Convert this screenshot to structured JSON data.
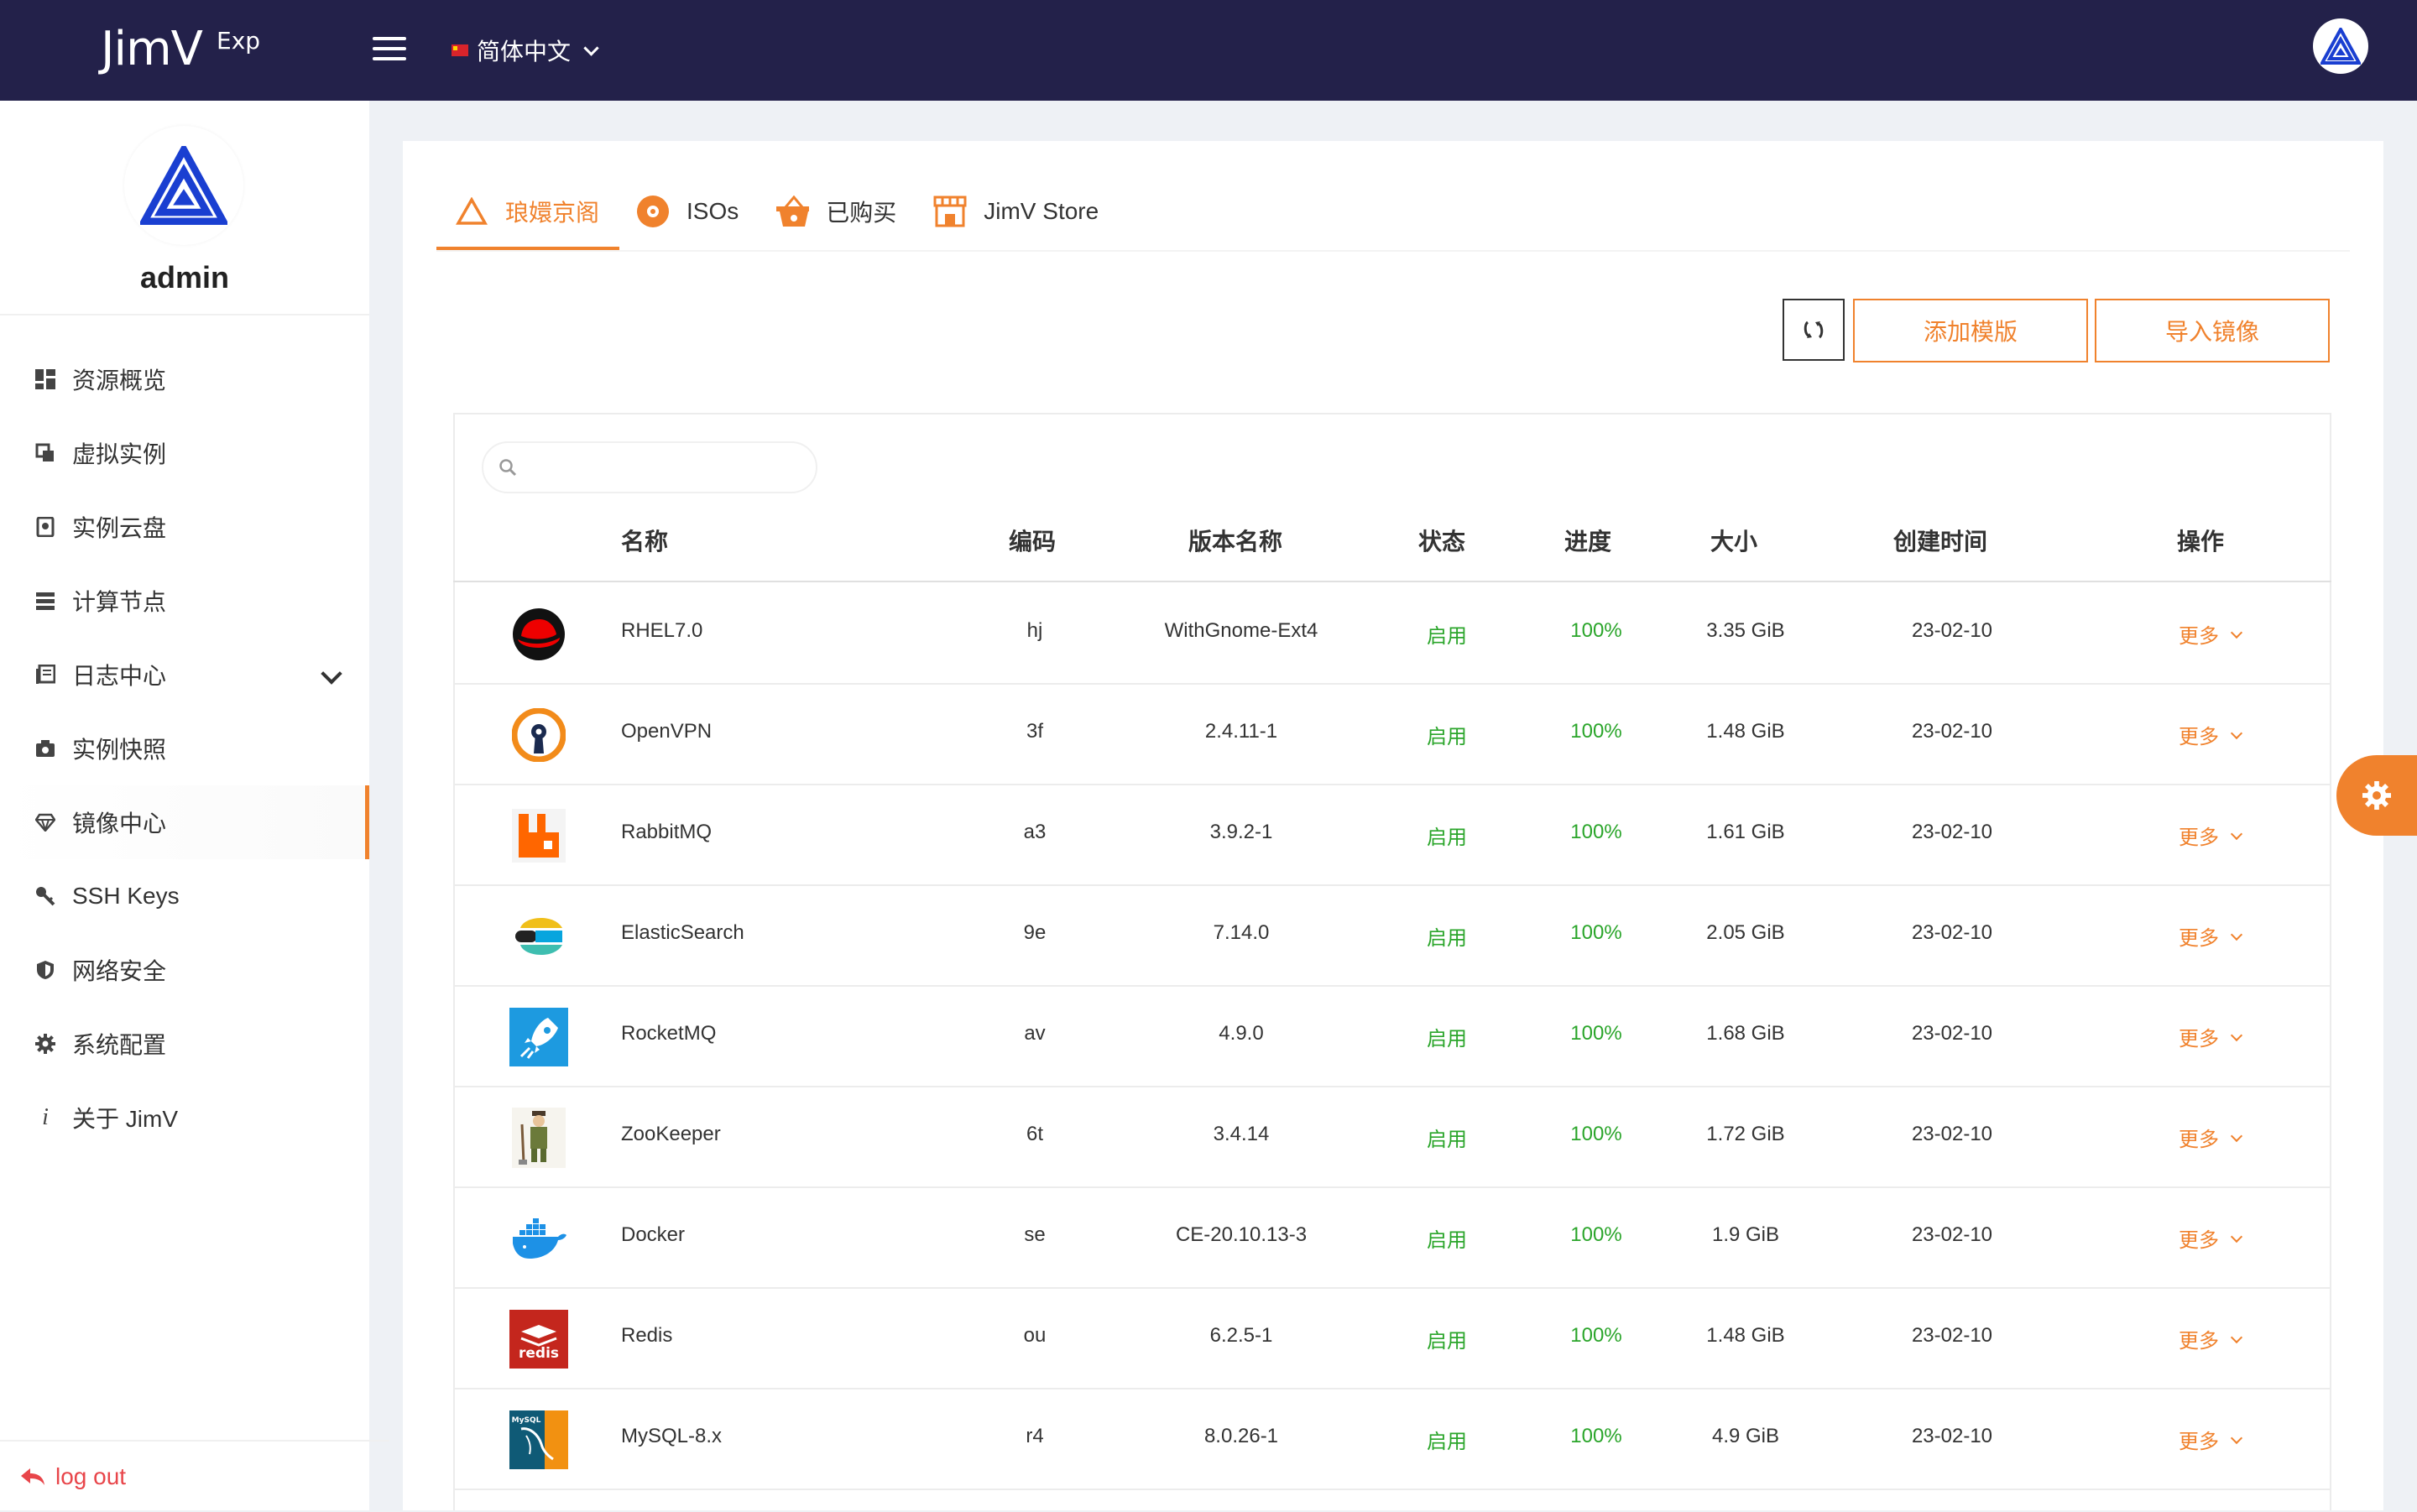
{
  "colors": {
    "topbar": "#23214a",
    "accent": "#f0822d",
    "status_ok": "#2aa52a",
    "logout": "#e8454a"
  },
  "header": {
    "logo": "JimV",
    "logo_sup": "Exp",
    "menu_icon": "hamburger-icon",
    "language": "简体中文"
  },
  "sidebar": {
    "username": "admin",
    "items": [
      {
        "label": "资源概览",
        "icon": "dashboard-icon"
      },
      {
        "label": "虚拟实例",
        "icon": "instances-icon"
      },
      {
        "label": "实例云盘",
        "icon": "disk-icon"
      },
      {
        "label": "计算节点",
        "icon": "server-icon"
      },
      {
        "label": "日志中心",
        "icon": "log-icon"
      },
      {
        "label": "实例快照",
        "icon": "camera-icon"
      },
      {
        "label": "镜像中心",
        "icon": "gem-icon"
      },
      {
        "label": "SSH Keys",
        "icon": "key-icon"
      },
      {
        "label": "网络安全",
        "icon": "shield-icon"
      },
      {
        "label": "系统配置",
        "icon": "gear-icon"
      },
      {
        "label": "关于 JimV",
        "icon": "info-icon"
      }
    ],
    "logout": "log out"
  },
  "tabs": [
    {
      "label": "琅嬛京阁",
      "icon": "triangle-icon"
    },
    {
      "label": "ISOs",
      "icon": "disc-icon"
    },
    {
      "label": "已购买",
      "icon": "basket-icon"
    },
    {
      "label": "JimV Store",
      "icon": "store-icon"
    }
  ],
  "toolbar": {
    "refresh_icon": "refresh-icon",
    "add_template": "添加模版",
    "import_image": "导入镜像"
  },
  "search": {
    "placeholder": ""
  },
  "table": {
    "columns": [
      "名称",
      "编码",
      "版本名称",
      "状态",
      "进度",
      "大小",
      "创建时间",
      "操作"
    ],
    "rows": [
      {
        "name": "RHEL7.0",
        "code": "hj",
        "version": "WithGnome-Ext4",
        "status": "启用",
        "progress": "100%",
        "size": "3.35 GiB",
        "created": "23-02-10",
        "action": "更多",
        "icon": "redhat-logo-icon"
      },
      {
        "name": "OpenVPN",
        "code": "3f",
        "version": "2.4.11-1",
        "status": "启用",
        "progress": "100%",
        "size": "1.48 GiB",
        "created": "23-02-10",
        "action": "更多",
        "icon": "openvpn-logo-icon"
      },
      {
        "name": "RabbitMQ",
        "code": "a3",
        "version": "3.9.2-1",
        "status": "启用",
        "progress": "100%",
        "size": "1.61 GiB",
        "created": "23-02-10",
        "action": "更多",
        "icon": "rabbitmq-logo-icon"
      },
      {
        "name": "ElasticSearch",
        "code": "9e",
        "version": "7.14.0",
        "status": "启用",
        "progress": "100%",
        "size": "2.05 GiB",
        "created": "23-02-10",
        "action": "更多",
        "icon": "elasticsearch-logo-icon"
      },
      {
        "name": "RocketMQ",
        "code": "av",
        "version": "4.9.0",
        "status": "启用",
        "progress": "100%",
        "size": "1.68 GiB",
        "created": "23-02-10",
        "action": "更多",
        "icon": "rocketmq-logo-icon"
      },
      {
        "name": "ZooKeeper",
        "code": "6t",
        "version": "3.4.14",
        "status": "启用",
        "progress": "100%",
        "size": "1.72 GiB",
        "created": "23-02-10",
        "action": "更多",
        "icon": "zookeeper-logo-icon"
      },
      {
        "name": "Docker",
        "code": "se",
        "version": "CE-20.10.13-3",
        "status": "启用",
        "progress": "100%",
        "size": "1.9 GiB",
        "created": "23-02-10",
        "action": "更多",
        "icon": "docker-logo-icon"
      },
      {
        "name": "Redis",
        "code": "ou",
        "version": "6.2.5-1",
        "status": "启用",
        "progress": "100%",
        "size": "1.48 GiB",
        "created": "23-02-10",
        "action": "更多",
        "icon": "redis-logo-icon"
      },
      {
        "name": "MySQL-8.x",
        "code": "r4",
        "version": "8.0.26-1",
        "status": "启用",
        "progress": "100%",
        "size": "4.9 GiB",
        "created": "23-02-10",
        "action": "更多",
        "icon": "mysql-logo-icon"
      }
    ]
  }
}
